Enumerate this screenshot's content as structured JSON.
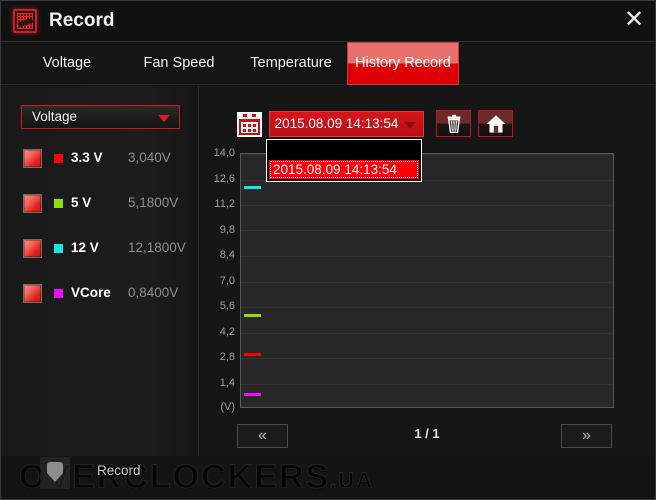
{
  "window": {
    "title": "Record",
    "app_icon": "record-chart-icon",
    "close_label": "✕"
  },
  "tabs": [
    {
      "label": "Voltage",
      "active": false,
      "left": 20,
      "width": 92
    },
    {
      "label": "Fan Speed",
      "active": false,
      "left": 130,
      "width": 96
    },
    {
      "label": "Temperature",
      "active": false,
      "left": 235,
      "width": 110
    },
    {
      "label": "History Record",
      "active": true,
      "left": 346,
      "width": 112
    }
  ],
  "sidebar": {
    "source_select": {
      "value": "Voltage",
      "options": [
        "Voltage",
        "Fan Speed",
        "Temperature"
      ],
      "arrow_icon": "chevron-down-icon"
    },
    "items": [
      {
        "name": "3.3 V",
        "value": "3,040V",
        "color": "#fb0007",
        "checked": true
      },
      {
        "name": "5 V",
        "value": "5,1800V",
        "color": "#8ee000",
        "checked": true
      },
      {
        "name": "12 V",
        "value": "12,1800V",
        "color": "#0ee8e8",
        "checked": true
      },
      {
        "name": "VCore",
        "value": "0,8400V",
        "color": "#ef0ef0",
        "checked": true
      }
    ]
  },
  "toolbar": {
    "calendar_icon": "calendar-icon",
    "date_value": "2015.08.09 14:13:54",
    "date_arrow_icon": "chevron-down-icon",
    "dropdown_open": true,
    "dropdown_options": [
      "2015.08.09 14:13:54"
    ],
    "delete_icon": "trash-icon",
    "home_icon": "home-icon"
  },
  "pager": {
    "prev_label": "«",
    "next_label": "»",
    "page_label": "1 / 1"
  },
  "statusbar": {
    "record_icon": "shield-check-icon",
    "record_label": "Record"
  },
  "watermark": {
    "text": "OVERCLOCKERS",
    "suffix": ".UA"
  },
  "chart_data": {
    "type": "line",
    "title": "",
    "xlabel": "",
    "ylabel": "(V)",
    "unit_label": "(V)",
    "ylim": [
      0,
      14.0
    ],
    "grid": true,
    "legend_position": "sidebar",
    "y_ticks": [
      "14,0",
      "12,6",
      "11,2",
      "9,8",
      "8,4",
      "7,0",
      "5,6",
      "4,2",
      "2,8",
      "1,4"
    ],
    "y_tick_values": [
      14.0,
      12.6,
      11.2,
      9.8,
      8.4,
      7.0,
      5.6,
      4.2,
      2.8,
      1.4
    ],
    "x": [
      "2015.08.09 14:13:54"
    ],
    "series": [
      {
        "name": "3.3 V",
        "color": "#fb0007",
        "values": [
          3.04
        ]
      },
      {
        "name": "5 V",
        "color": "#8ee000",
        "values": [
          5.18
        ]
      },
      {
        "name": "12 V",
        "color": "#0ee8e8",
        "values": [
          12.18
        ]
      },
      {
        "name": "VCore",
        "color": "#ef0ef0",
        "values": [
          0.84
        ]
      }
    ]
  }
}
